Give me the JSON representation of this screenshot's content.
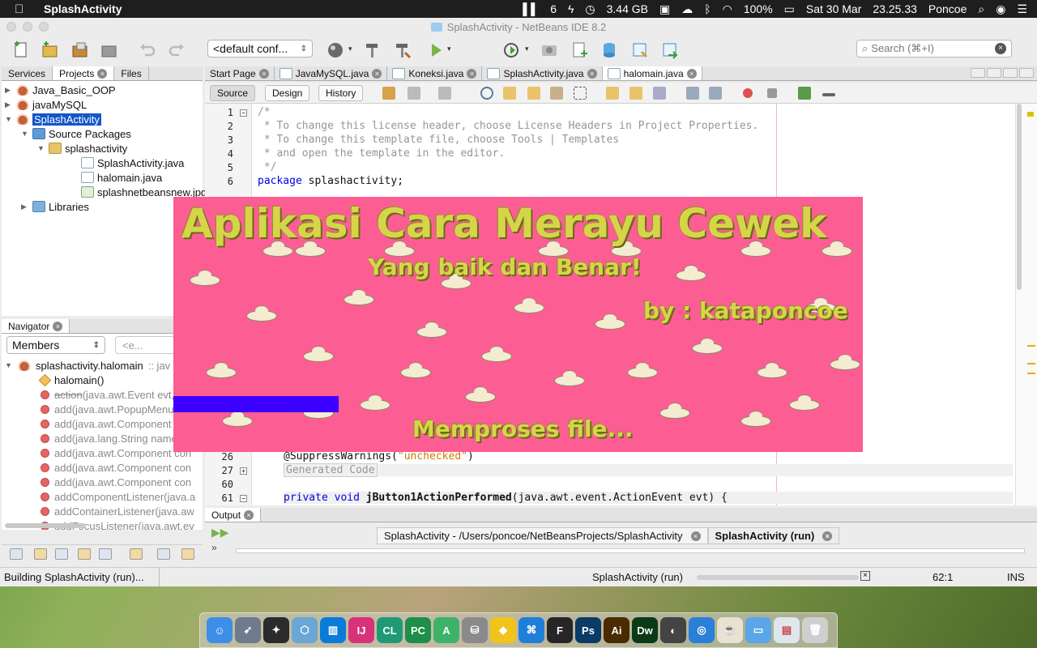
{
  "menubar": {
    "app_name": "SplashActivity",
    "status_items": [
      "6",
      "3.44 GB",
      "100%",
      "Sat 30 Mar",
      "23.25.33",
      "Poncoe"
    ]
  },
  "window": {
    "title": "SplashActivity - NetBeans IDE 8.2"
  },
  "toolbar": {
    "config_value": "<default conf...",
    "search_placeholder": "Search (⌘+I)"
  },
  "left_panel": {
    "tabs": [
      "Services",
      "Projects",
      "Files"
    ],
    "active_tab": "Projects"
  },
  "project_tree": [
    {
      "label": "Java_Basic_OOP",
      "icon": "project-icon"
    },
    {
      "label": "javaMySQL",
      "icon": "project-icon"
    },
    {
      "label": "SplashActivity",
      "icon": "project-icon",
      "selected": true
    },
    {
      "label": "Source Packages",
      "icon": "source-packages-icon"
    },
    {
      "label": "splashactivity",
      "icon": "package-icon"
    },
    {
      "label": "SplashActivity.java",
      "icon": "java-file-icon"
    },
    {
      "label": "halomain.java",
      "icon": "java-file-icon"
    },
    {
      "label": "splashnetbeansnew.jpg",
      "icon": "image-file-icon"
    },
    {
      "label": "Libraries",
      "icon": "libraries-icon"
    }
  ],
  "navigator": {
    "title": "Navigator",
    "filter_value": "Members",
    "filter2_placeholder": "<e...",
    "root": "splashactivity.halomain",
    "root_suffix": ":: jav",
    "items": [
      {
        "name": "halomain()",
        "rest": "",
        "type": "constructor"
      },
      {
        "name": "action",
        "rest": "(java.awt.Event evt,",
        "type": "method",
        "strike": true
      },
      {
        "name": "add",
        "rest": "(java.awt.PopupMenu",
        "type": "method"
      },
      {
        "name": "add",
        "rest": "(java.awt.Component",
        "type": "method"
      },
      {
        "name": "add",
        "rest": "(java.lang.String name",
        "type": "method"
      },
      {
        "name": "add",
        "rest": "(java.awt.Component con",
        "type": "method"
      },
      {
        "name": "add",
        "rest": "(java.awt.Component con",
        "type": "method"
      },
      {
        "name": "add",
        "rest": "(java.awt.Component con",
        "type": "method"
      },
      {
        "name": "addComponentListener",
        "rest": "(java.a",
        "type": "method"
      },
      {
        "name": "addContainerListener",
        "rest": "(java.aw",
        "type": "method"
      },
      {
        "name": "addFocusListener",
        "rest": "(java.awt.ev",
        "type": "method"
      }
    ]
  },
  "editor": {
    "tabs": [
      "Start Page",
      "JavaMySQL.java",
      "Koneksi.java",
      "SplashActivity.java",
      "halomain.java"
    ],
    "active_tab": "halomain.java",
    "view_buttons": [
      "Source",
      "Design",
      "History"
    ],
    "active_view": "Source",
    "lines": [
      {
        "n": "1",
        "text": "/*",
        "cls": "cm",
        "fold": true
      },
      {
        "n": "2",
        "text": " * To change this license header, choose License Headers in Project Properties.",
        "cls": "cm"
      },
      {
        "n": "3",
        "text": " * To change this template file, choose Tools | Templates",
        "cls": "cm"
      },
      {
        "n": "4",
        "text": " * and open the template in the editor.",
        "cls": "cm"
      },
      {
        "n": "5",
        "text": " */",
        "cls": "cm"
      },
      {
        "n": "6",
        "text": "splashactivity;",
        "kw": "package ",
        "cls": ""
      },
      {
        "n": "26",
        "text": "@SuppressWarnings(",
        "str": "\"unchecked\"",
        "tail": ")",
        "cls": ""
      },
      {
        "n": "27",
        "text": "Generated Code",
        "cls": "cm",
        "fold": true
      },
      {
        "n": "60",
        "text": "",
        "cls": ""
      },
      {
        "n": "61",
        "text": "(java.awt.event.ActionEvent evt) {",
        "kw": "private void ",
        "method": "jButton1ActionPerformed",
        "cls": "",
        "fold": true
      }
    ]
  },
  "splash": {
    "title": "Aplikasi Cara Merayu Cewek",
    "subtitle": "Yang baik dan Benar!",
    "author": "by : kataponcoe",
    "status": "Memproses file...",
    "progress_fraction": 0.24,
    "bg_color": "#fc5d93",
    "bar_color": "#3c00ff"
  },
  "output": {
    "title": "Output",
    "tabs": [
      "SplashActivity - /Users/poncoe/NetBeansProjects/SplashActivity",
      "SplashActivity (run)"
    ],
    "active_tab": "SplashActivity (run)"
  },
  "statusbar": {
    "left": "Building SplashActivity (run)...",
    "task": "SplashActivity (run)",
    "position": "62:1",
    "mode": "INS"
  },
  "dock": {
    "apps": [
      "Finder",
      "Launchpad",
      "Final Cut Pro",
      "VirtualBox",
      "Trello",
      "IntelliJ IDEA",
      "CLion",
      "PyCharm",
      "Android Studio",
      "Sequel Pro",
      "Cyberduck",
      "Visual Studio Code",
      "Figma",
      "Photoshop",
      "Illustrator",
      "Dreamweaver",
      "DaVinci Resolve",
      "Safari",
      "Java",
      "Downloads",
      "Preview",
      "Trash"
    ]
  }
}
